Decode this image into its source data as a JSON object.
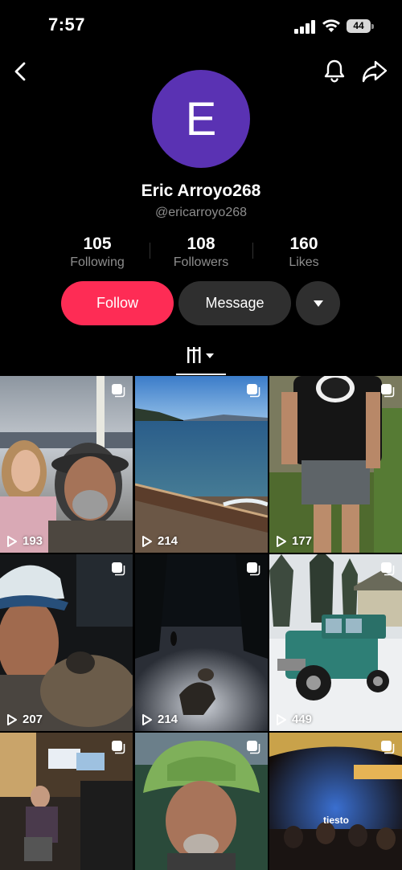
{
  "status_bar": {
    "time": "7:57",
    "battery": "44"
  },
  "profile": {
    "avatar_letter": "E",
    "name": "Eric Arroyo268",
    "handle": "@ericarroyo268",
    "stats": [
      {
        "value": "105",
        "label": "Following"
      },
      {
        "value": "108",
        "label": "Followers"
      },
      {
        "value": "160",
        "label": "Likes"
      }
    ]
  },
  "actions": {
    "follow": "Follow",
    "message": "Message"
  },
  "videos": [
    {
      "views": "193"
    },
    {
      "views": "214"
    },
    {
      "views": "177"
    },
    {
      "views": "207"
    },
    {
      "views": "214"
    },
    {
      "views": "449"
    },
    {
      "views": ""
    },
    {
      "views": ""
    },
    {
      "views": "",
      "overlay_text": "tiesto"
    }
  ],
  "colors": {
    "follow": "#fe2c55",
    "avatar": "#5a32b3",
    "secondary_text": "#8d8d8d"
  }
}
